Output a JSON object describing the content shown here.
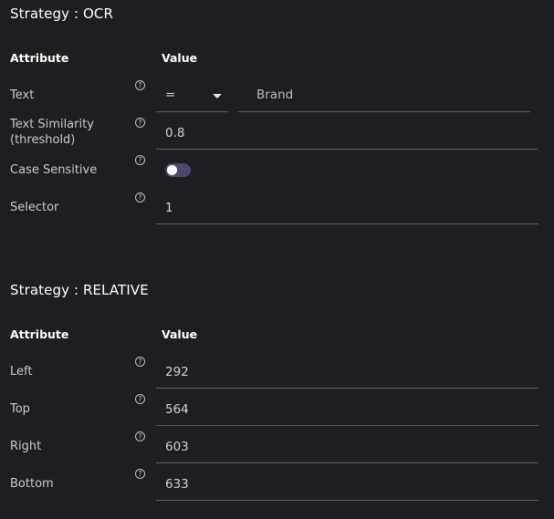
{
  "ocr": {
    "title": "Strategy : OCR",
    "header_attribute": "Attribute",
    "header_value": "Value",
    "text_label": "Text",
    "text_operator": "=",
    "text_value": "Brand",
    "similarity_label_line1": "Text Similarity",
    "similarity_label_line2": "(threshold)",
    "similarity_value": "0.8",
    "case_label": "Case Sensitive",
    "case_sensitive": false,
    "selector_label": "Selector",
    "selector_value": "1"
  },
  "relative": {
    "title": "Strategy : RELATIVE",
    "header_attribute": "Attribute",
    "header_value": "Value",
    "left_label": "Left",
    "left_value": "292",
    "top_label": "Top",
    "top_value": "564",
    "right_label": "Right",
    "right_value": "603",
    "bottom_label": "Bottom",
    "bottom_value": "633"
  },
  "help_glyph": "?",
  "colors": {
    "background": "#1e1e22",
    "toggle_track": "#4b4a6e"
  }
}
